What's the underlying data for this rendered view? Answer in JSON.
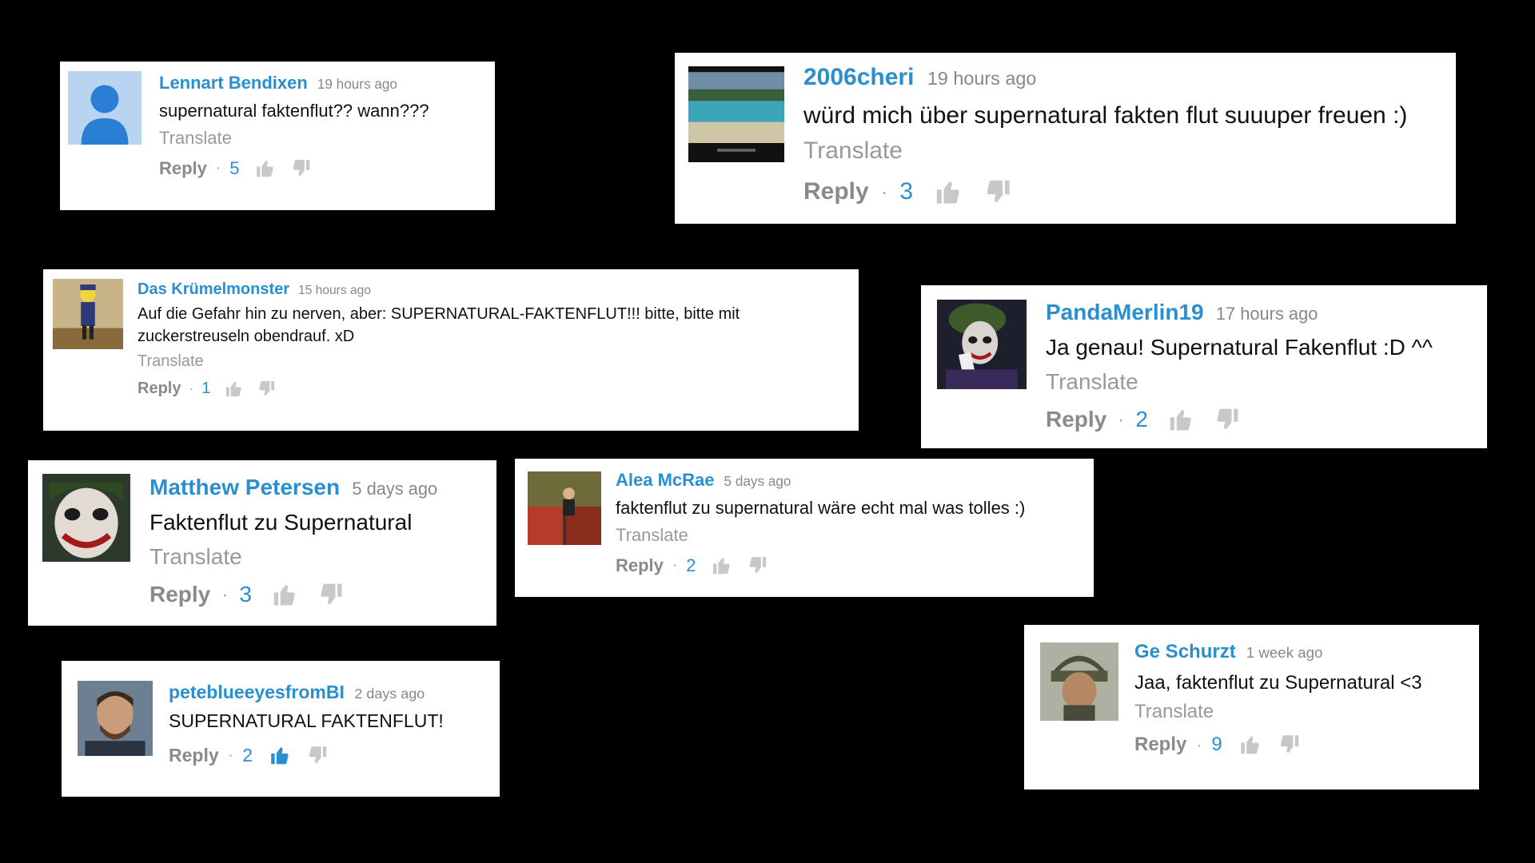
{
  "ui": {
    "reply_label": "Reply",
    "translate_label": "Translate"
  },
  "colors": {
    "background": "#000000",
    "username": "#2a8fd0",
    "timestamp": "#888888",
    "action": "#8a8a8a",
    "thumbs_icon": "#c8c8c8"
  },
  "comments": [
    {
      "author": "Lennart Bendixen",
      "time": "19 hours ago",
      "text": "supernatural faktenflut?? wann???",
      "likes": "5",
      "avatar_icon": "default-user-silhouette-icon"
    },
    {
      "author": "2006cheri",
      "time": "19 hours ago",
      "text": "würd mich über supernatural fakten flut suuuper freuen :)",
      "likes": "3",
      "avatar_icon": "beach-photo"
    },
    {
      "author": "Das Krümelmonster",
      "time": "15 hours ago",
      "text": "Auf die Gefahr hin zu nerven, aber: SUPERNATURAL-FAKTENFLUT!!! bitte, bitte mit zuckerstreuseln obendrauf. xD",
      "likes": "1",
      "avatar_icon": "cartoon-character"
    },
    {
      "author": "PandaMerlin19",
      "time": "17 hours ago",
      "text": "Ja genau! Supernatural Fakenflut :D ^^",
      "likes": "2",
      "avatar_icon": "joker-photo"
    },
    {
      "author": "Matthew Petersen",
      "time": "5 days ago",
      "text": "Faktenflut zu Supernatural",
      "likes": "3",
      "avatar_icon": "joker-face-photo"
    },
    {
      "author": "Alea McRae",
      "time": "5 days ago",
      "text": "faktenflut zu supernatural wäre echt mal was tolles :)",
      "likes": "2",
      "avatar_icon": "collage-photo"
    },
    {
      "author": "peteblueeyesfromBI",
      "time": "2 days ago",
      "text": "SUPERNATURAL FAKTENFLUT!",
      "likes": "2",
      "avatar_icon": "man-portrait-photo"
    },
    {
      "author": "Ge Schurzt",
      "time": "1 week ago",
      "text": "Jaa, faktenflut zu Supernatural <3",
      "likes": "9",
      "avatar_icon": "soldier-helmet-photo"
    }
  ]
}
